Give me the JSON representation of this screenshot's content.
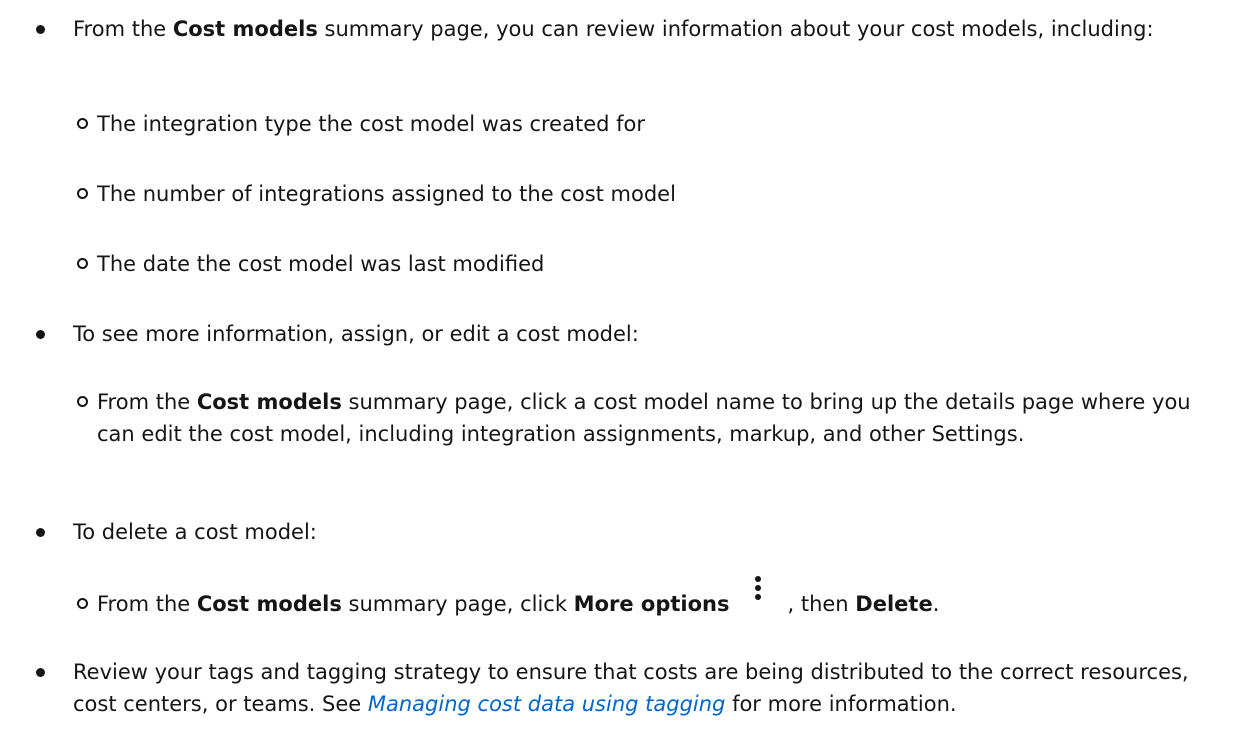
{
  "items": [
    {
      "pre": "From the ",
      "bold": "Cost models",
      "post": " summary page, you can review information about your cost models, including:",
      "sub": [
        "The integration type the cost model was created for",
        "The number of integrations assigned to the cost model",
        "The date the cost model was last modified"
      ]
    },
    {
      "text": "To see more information, assign, or edit a cost model:",
      "sub": [
        {
          "pre": "From the ",
          "bold": "Cost models",
          "post": " summary page, click a cost model name to bring up the details page where you can edit the cost model, including integration assignments, markup, and other Settings."
        }
      ]
    },
    {
      "text": "To delete a cost model:",
      "sub": [
        {
          "pre": "From the ",
          "bold": "Cost models",
          "mid": " summary page, click ",
          "bold2": "More options",
          "icon": "kebab-vertical-icon",
          "mid2": ", then ",
          "bold3": "Delete",
          "end": "."
        }
      ]
    },
    {
      "pre": "Review your tags and tagging strategy to ensure that costs are being distributed to the correct resources, cost centers, or teams. See ",
      "link": "Managing cost data using tagging",
      "post": " for more information."
    }
  ]
}
